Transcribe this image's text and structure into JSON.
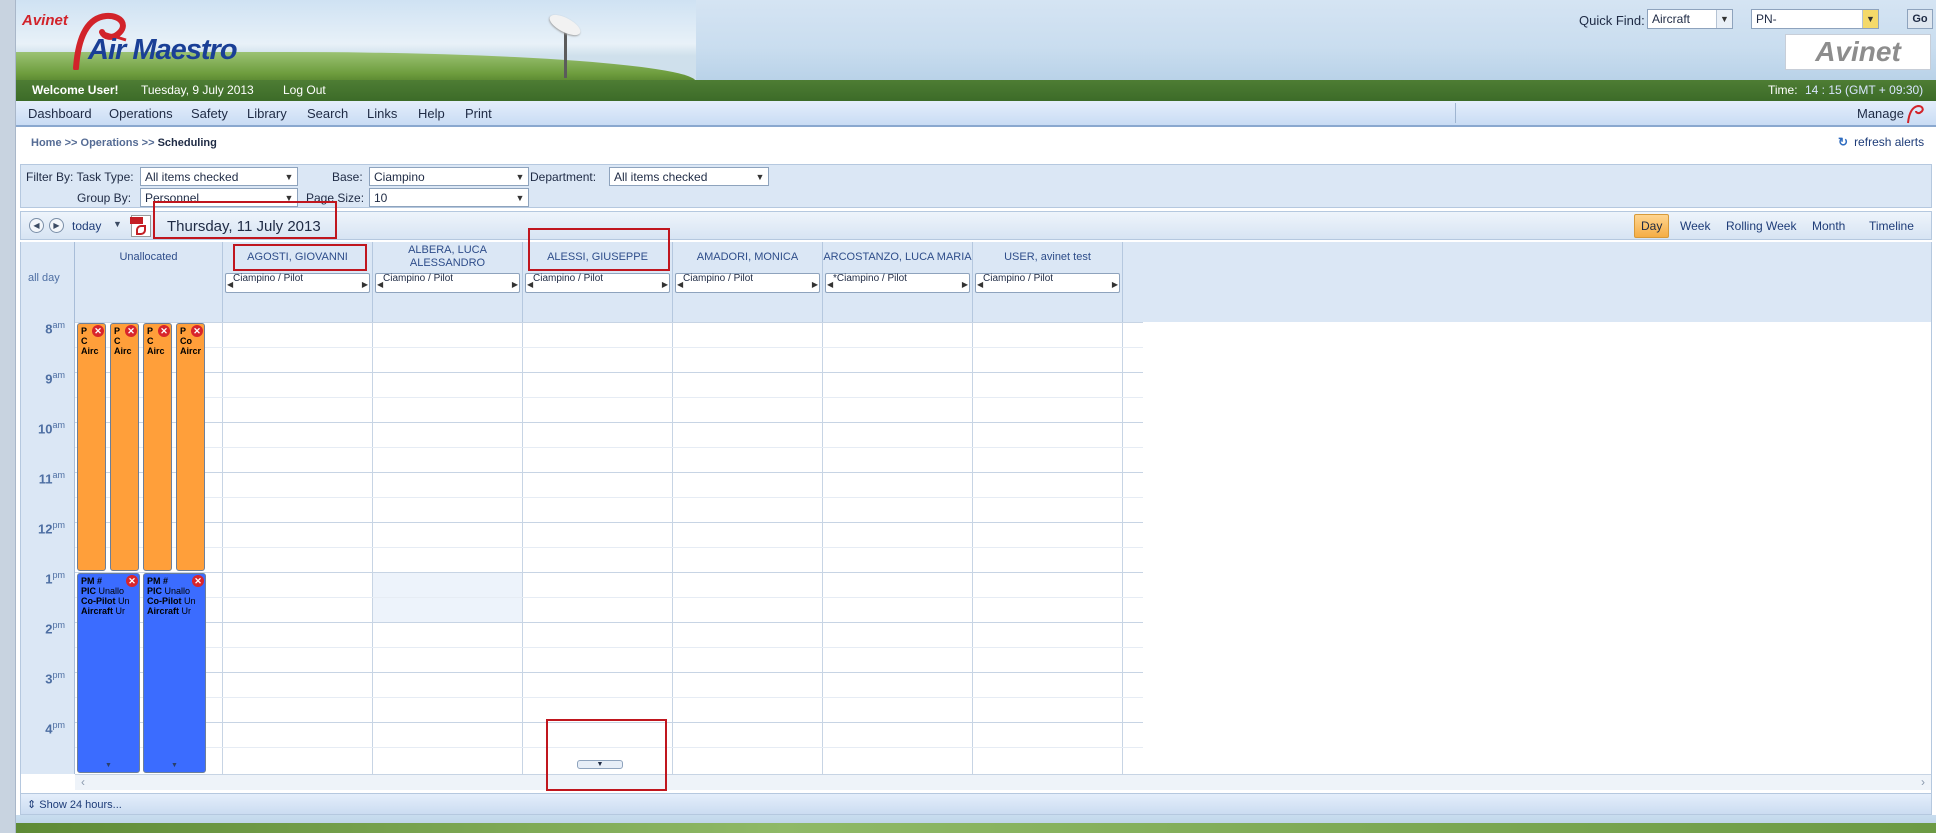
{
  "header": {
    "logo_small": "Avinet",
    "logo_main": "Air Maestro",
    "quick_find_label": "Quick Find:",
    "quick_find_type": "Aircraft",
    "quick_find_value": "PN-",
    "go_label": "Go",
    "brand_logo": "Avinet"
  },
  "userbar": {
    "welcome": "Welcome User!",
    "date": "Tuesday, 9 July 2013",
    "logout": "Log Out",
    "time_label": "Time:",
    "time_value": "14 : 15 (GMT + 09:30)"
  },
  "nav": {
    "items": [
      "Dashboard",
      "Operations",
      "Safety",
      "Library",
      "Search",
      "Links",
      "Help",
      "Print"
    ],
    "manage": "Manage"
  },
  "breadcrumb": {
    "home": "Home >>",
    "operations": "Operations >>",
    "current": "Scheduling"
  },
  "refresh_alerts": "refresh alerts",
  "filters": {
    "filter_by_label": "Filter By: Task Type:",
    "task_type": "All items checked",
    "base_label": "Base:",
    "base": "Ciampino",
    "department_label": "Department:",
    "department": "All items checked",
    "group_by_label": "Group By:",
    "group_by": "Personnel",
    "page_size_label": "Page Size:",
    "page_size": "10"
  },
  "toolbar": {
    "today": "today",
    "current_date": "Thursday, 11 July 2013",
    "views": [
      "Day",
      "Week",
      "Rolling Week",
      "Month",
      "Timeline"
    ],
    "active_view": "Day"
  },
  "calendar": {
    "all_day": "all day",
    "columns": [
      {
        "name": "Unallocated",
        "sub": ""
      },
      {
        "name": "AGOSTI, GIOVANNI",
        "sub": "Ciampino / Pilot"
      },
      {
        "name": "ALBERA, LUCA ALESSANDRO",
        "sub": "Ciampino / Pilot"
      },
      {
        "name": "ALESSI, GIUSEPPE",
        "sub": "Ciampino / Pilot"
      },
      {
        "name": "AMADORI, MONICA",
        "sub": "Ciampino / Pilot"
      },
      {
        "name": "ARCOSTANZO, LUCA MARIA",
        "sub": "*Ciampino / Pilot"
      },
      {
        "name": "USER, avinet test",
        "sub": "Ciampino / Pilot"
      }
    ],
    "hours": [
      {
        "h": "8",
        "ap": "am"
      },
      {
        "h": "9",
        "ap": "am"
      },
      {
        "h": "10",
        "ap": "am"
      },
      {
        "h": "11",
        "ap": "am"
      },
      {
        "h": "12",
        "ap": "pm"
      },
      {
        "h": "1",
        "ap": "pm"
      },
      {
        "h": "2",
        "ap": "pm"
      },
      {
        "h": "3",
        "ap": "pm"
      },
      {
        "h": "4",
        "ap": "pm"
      }
    ],
    "orange_events": [
      {
        "l1": "P",
        "l2": "C",
        "l3": "Airc"
      },
      {
        "l1": "P",
        "l2": "C",
        "l3": "Airc"
      },
      {
        "l1": "P",
        "l2": "C",
        "l3": "Airc"
      },
      {
        "l1": "P",
        "l2": "Co",
        "l3": "Aircr"
      }
    ],
    "blue_events": [
      {
        "l1": "PM #",
        "l2": "PIC",
        "l2b": "Unallo",
        "l3": "Co-Pilot",
        "l3b": "Un",
        "l4": "Aircraft",
        "l4b": "Ur"
      },
      {
        "l1": "PM #",
        "l2": "PIC",
        "l2b": "Unallo",
        "l3": "Co-Pilot",
        "l3b": "Un",
        "l4": "Aircraft",
        "l4b": "Ur"
      }
    ]
  },
  "footer": {
    "show_24": "Show 24 hours..."
  },
  "colors": {
    "accent": "#1e3c78",
    "orange_event": "#ff9f3a",
    "blue_event": "#3b6cff",
    "highlight": "#c0161e"
  },
  "icons": [
    "prev-arrow-icon",
    "next-arrow-icon",
    "pdf-icon",
    "refresh-icon",
    "close-icon",
    "manage-logo-icon",
    "scroll-down-icon",
    "expand-icon"
  ]
}
